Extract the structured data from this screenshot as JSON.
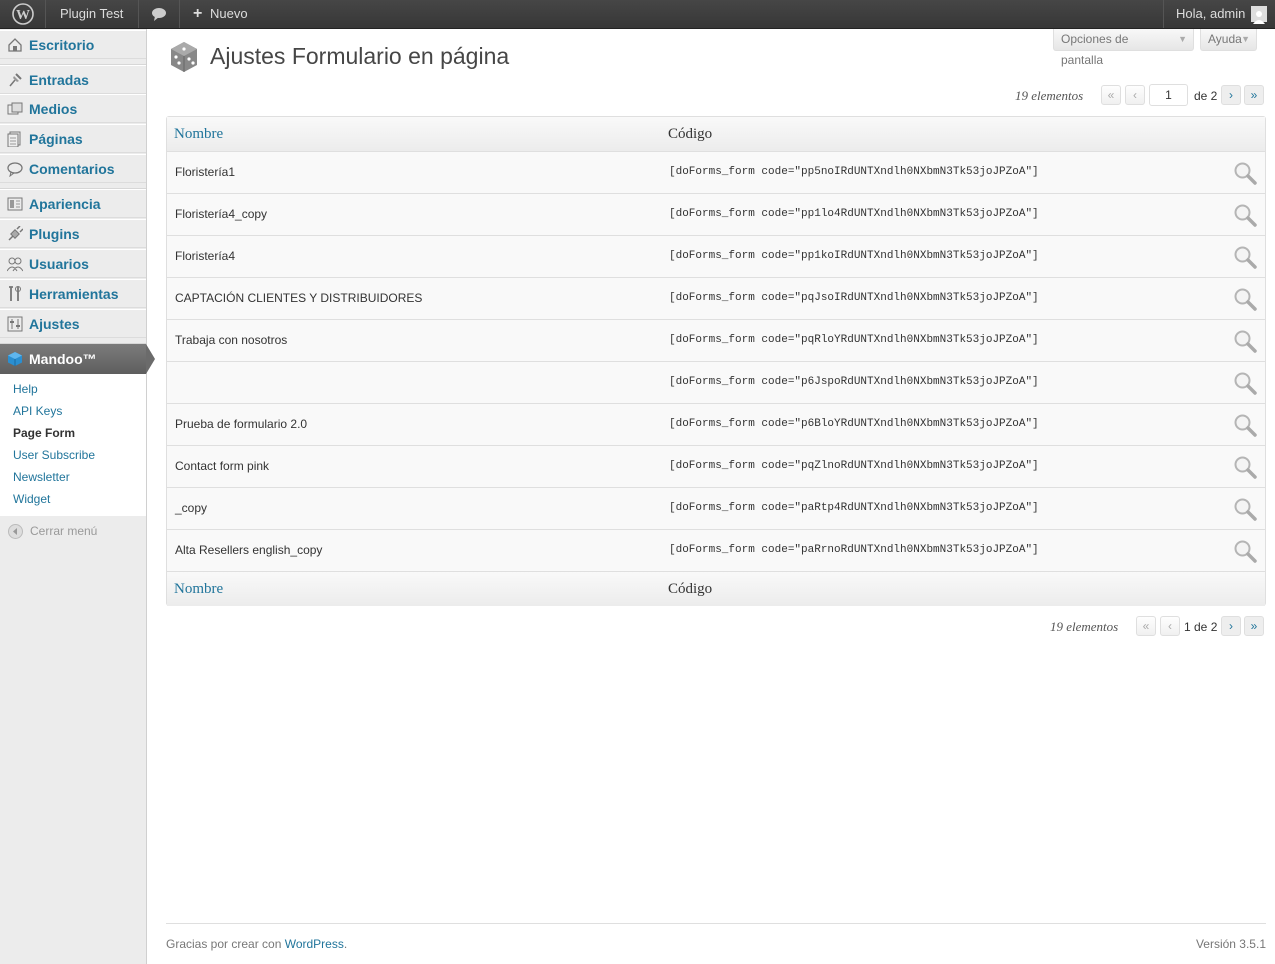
{
  "adminbar": {
    "site_name": "Plugin Test",
    "new_label": "Nuevo",
    "greeting": "Hola, admin"
  },
  "sidebar": {
    "items": [
      {
        "label": "Escritorio",
        "icon": "dashboard-icon"
      },
      {
        "label": "Entradas",
        "icon": "pin-icon"
      },
      {
        "label": "Medios",
        "icon": "media-icon"
      },
      {
        "label": "Páginas",
        "icon": "pages-icon"
      },
      {
        "label": "Comentarios",
        "icon": "comments-icon"
      },
      {
        "label": "Apariencia",
        "icon": "appearance-icon"
      },
      {
        "label": "Plugins",
        "icon": "plugins-icon"
      },
      {
        "label": "Usuarios",
        "icon": "users-icon"
      },
      {
        "label": "Herramientas",
        "icon": "tools-icon"
      },
      {
        "label": "Ajustes",
        "icon": "settings-icon"
      }
    ],
    "active": {
      "label": "Mandoo™",
      "icon": "cube-icon"
    },
    "submenu": [
      {
        "label": "Help"
      },
      {
        "label": "API Keys"
      },
      {
        "label": "Page Form",
        "current": true
      },
      {
        "label": "User Subscribe"
      },
      {
        "label": "Newsletter"
      },
      {
        "label": "Widget"
      }
    ],
    "collapse_label": "Cerrar menú"
  },
  "header": {
    "screen_options": "Opciones de pantalla",
    "help": "Ayuda",
    "title": "Ajustes Formulario en página"
  },
  "pagination_top": {
    "count": "19 elementos",
    "first": "«",
    "prev": "‹",
    "current_page": "1",
    "of_total": "de 2",
    "next": "›",
    "last": "»"
  },
  "table": {
    "columns": [
      "Nombre",
      "Código"
    ],
    "rows": [
      {
        "name": "Floristería1",
        "code": "[doForms_form code=\"pp5noIRdUNTXndlh0NXbmN3Tk53joJPZoA\"]"
      },
      {
        "name": "Floristería4_copy",
        "code": "[doForms_form code=\"pp1lo4RdUNTXndlh0NXbmN3Tk53joJPZoA\"]"
      },
      {
        "name": "Floristería4",
        "code": "[doForms_form code=\"pp1koIRdUNTXndlh0NXbmN3Tk53joJPZoA\"]"
      },
      {
        "name": "CAPTACIÓN CLIENTES Y DISTRIBUIDORES",
        "code": "[doForms_form code=\"pqJsoIRdUNTXndlh0NXbmN3Tk53joJPZoA\"]"
      },
      {
        "name": "Trabaja con nosotros",
        "code": "[doForms_form code=\"pqRloYRdUNTXndlh0NXbmN3Tk53joJPZoA\"]"
      },
      {
        "name": "",
        "code": "[doForms_form code=\"p6JspoRdUNTXndlh0NXbmN3Tk53joJPZoA\"]"
      },
      {
        "name": "Prueba de formulario 2.0",
        "code": "[doForms_form code=\"p6BloYRdUNTXndlh0NXbmN3Tk53joJPZoA\"]"
      },
      {
        "name": "Contact form pink",
        "code": "[doForms_form code=\"pqZlnoRdUNTXndlh0NXbmN3Tk53joJPZoA\"]"
      },
      {
        "name": "_copy",
        "code": "[doForms_form code=\"paRtp4RdUNTXndlh0NXbmN3Tk53joJPZoA\"]"
      },
      {
        "name": "Alta Resellers english_copy",
        "code": "[doForms_form code=\"paRrnoRdUNTXndlh0NXbmN3Tk53joJPZoA\"]"
      }
    ]
  },
  "pagination_bottom": {
    "count": "19 elementos",
    "first": "«",
    "prev": "‹",
    "page_text": "1 de 2",
    "next": "›",
    "last": "»"
  },
  "footer": {
    "thanks_prefix": "Gracias por crear con ",
    "thanks_link": "WordPress",
    "thanks_suffix": ".",
    "version": "Versión 3.5.1"
  },
  "colors": {
    "link": "#21759b",
    "adminbar_bg": "#464646",
    "sidebar_bg": "#ececec"
  }
}
